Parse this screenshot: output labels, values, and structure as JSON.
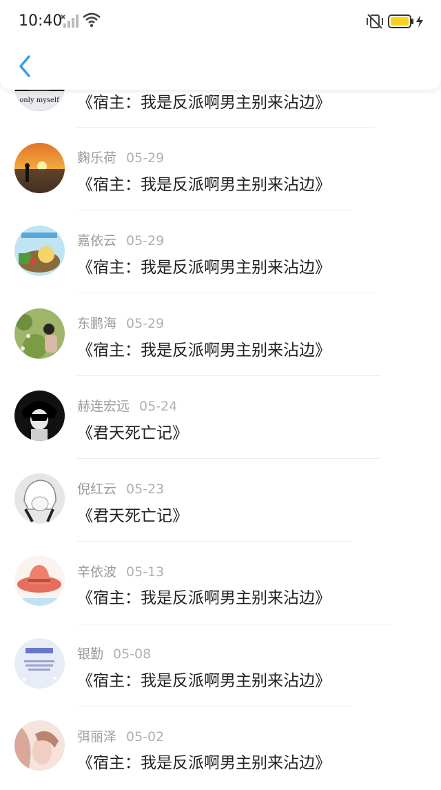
{
  "status_bar": {
    "time": "10:40",
    "battery_color": "#F7D219"
  },
  "header": {
    "back_icon": "chevron-left-icon",
    "accent": "#2F9CF0"
  },
  "comments": [
    {
      "name": "",
      "date": "",
      "title": "《宿主：我是反派啊男主别来沾边》",
      "avatar_text": "only myself"
    },
    {
      "name": "麴乐荷",
      "date": "05-29",
      "title": "《宿主：我是反派啊男主别来沾边》"
    },
    {
      "name": "嘉依云",
      "date": "05-29",
      "title": "《宿主：我是反派啊男主别来沾边》"
    },
    {
      "name": "东鹏海",
      "date": "05-29",
      "title": "《宿主：我是反派啊男主别来沾边》"
    },
    {
      "name": "赫连宏远",
      "date": "05-24",
      "title": "《君天死亡记》"
    },
    {
      "name": "倪红云",
      "date": "05-23",
      "title": "《君天死亡记》"
    },
    {
      "name": "辛依波",
      "date": "05-13",
      "title": "《宿主：我是反派啊男主别来沾边》"
    },
    {
      "name": "银勤",
      "date": "05-08",
      "title": "《宿主：我是反派啊男主别来沾边》"
    },
    {
      "name": "弭丽泽",
      "date": "05-02",
      "title": "《宿主：我是反派啊男主别来沾边》"
    }
  ]
}
